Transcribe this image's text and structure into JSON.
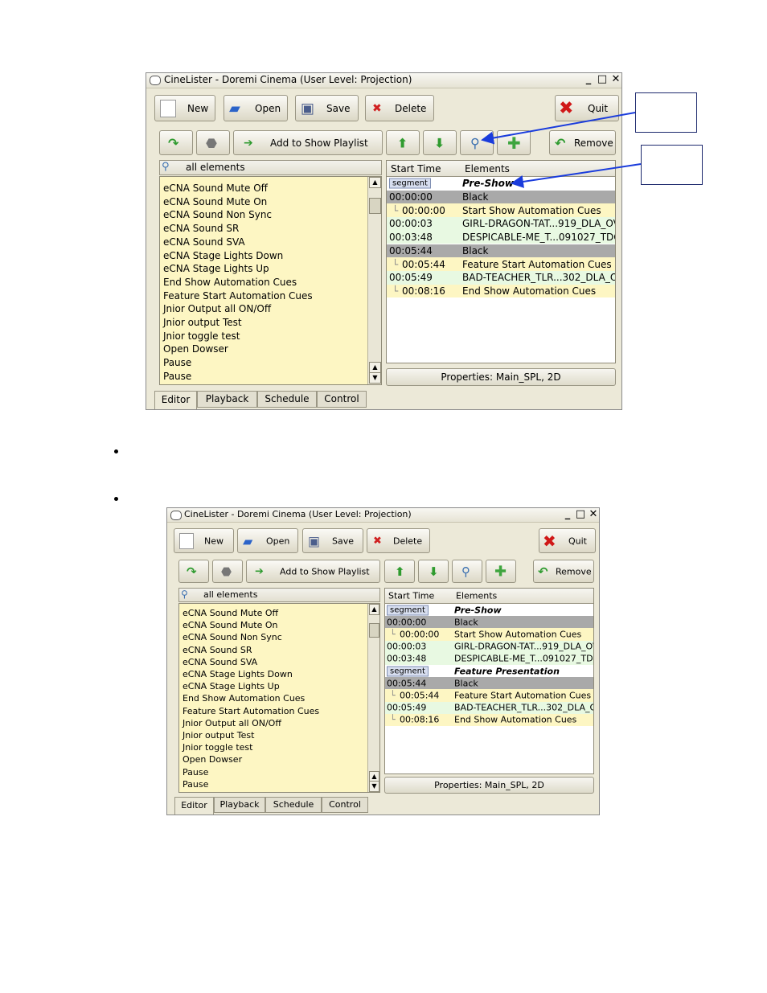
{
  "window_title": "CineLister - Doremi Cinema (User Level: Projection)",
  "toolbar": {
    "new_label": "New",
    "open_label": "Open",
    "save_label": "Save",
    "delete_label": "Delete",
    "quit_label": "Quit",
    "add_to_show_playlist_label": "Add to Show Playlist",
    "remove_label": "Remove"
  },
  "search": {
    "label": "all elements"
  },
  "elements_list": [
    "eCNA Sound Mute Off",
    "eCNA Sound Mute On",
    "eCNA Sound Non Sync",
    "eCNA Sound SR",
    "eCNA Sound SVA",
    "eCNA Stage Lights Down",
    "eCNA Stage Lights Up",
    "End Show Automation Cues",
    "Feature Start Automation Cues",
    "Jnior Output all ON/Off",
    "Jnior output Test",
    "Jnior toggle test",
    "Open Dowser",
    "Pause",
    "Pause"
  ],
  "playlist": {
    "col_start_time": "Start Time",
    "col_elements": "Elements",
    "segment_badge": "segment",
    "rows_first": [
      {
        "time": "",
        "element": "Pre-Show"
      },
      {
        "time": "00:00:00",
        "element": "Black"
      },
      {
        "time": "00:00:00",
        "element": "Start Show Automation Cues"
      },
      {
        "time": "00:00:03",
        "element": "GIRL-DRAGON-TAT...919_DLA_OV"
      },
      {
        "time": "00:03:48",
        "element": "DESPICABLE-ME_T...091027_TDC"
      },
      {
        "time": "00:05:44",
        "element": "Black"
      },
      {
        "time": "00:05:44",
        "element": "Feature Start Automation Cues"
      },
      {
        "time": "00:05:49",
        "element": "BAD-TEACHER_TLR...302_DLA_OV"
      },
      {
        "time": "00:08:16",
        "element": "End Show Automation Cues"
      }
    ],
    "rows_second": [
      {
        "time": "",
        "element": "Pre-Show"
      },
      {
        "time": "00:00:00",
        "element": "Black"
      },
      {
        "time": "00:00:00",
        "element": "Start Show Automation Cues"
      },
      {
        "time": "00:00:03",
        "element": "GIRL-DRAGON-TAT...919_DLA_OV"
      },
      {
        "time": "00:03:48",
        "element": "DESPICABLE-ME_T...091027_TDC"
      },
      {
        "time": "",
        "element": "Feature Presentation"
      },
      {
        "time": "00:05:44",
        "element": "Black"
      },
      {
        "time": "00:05:44",
        "element": "Feature Start Automation Cues"
      },
      {
        "time": "00:05:49",
        "element": "BAD-TEACHER_TLR...302_DLA_OV"
      },
      {
        "time": "00:08:16",
        "element": "End Show Automation Cues"
      }
    ]
  },
  "properties_label": "Properties: Main_SPL, 2D",
  "tabs": [
    "Editor",
    "Playback",
    "Schedule",
    "Control"
  ],
  "colors": {
    "list_bg": "#fdf6c3",
    "row_dark": "#a9a9a9",
    "row_green": "#e8f9e2",
    "arrow_blue": "#1a3cdc"
  }
}
